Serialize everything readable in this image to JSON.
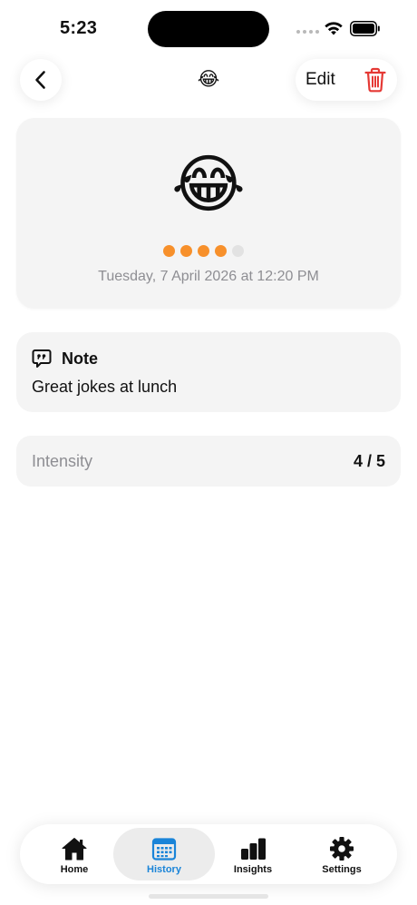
{
  "status_bar": {
    "time": "5:23"
  },
  "header": {
    "back_icon": "chevron-left-icon",
    "emoji": "😂",
    "edit_label": "Edit",
    "delete_icon": "trash-icon"
  },
  "mood": {
    "emoji": "😂",
    "intensity": 4,
    "intensity_max": 5,
    "date_text": "Tuesday, 7 April 2026 at 12:20 PM"
  },
  "note": {
    "title": "Note",
    "text": "Great jokes at lunch"
  },
  "intensity_row": {
    "label": "Intensity",
    "value": "4 / 5"
  },
  "tabs": [
    {
      "label": "Home",
      "icon": "house-icon",
      "active": false
    },
    {
      "label": "History",
      "icon": "calendar-icon",
      "active": true
    },
    {
      "label": "Insights",
      "icon": "bar-chart-icon",
      "active": false
    },
    {
      "label": "Settings",
      "icon": "gear-icon",
      "active": false
    }
  ],
  "colors": {
    "accent": "#1a84d8",
    "intensity_on": "#f7902b",
    "intensity_off": "#e2e2e2",
    "delete": "#e53935",
    "card_bg": "#f4f4f4",
    "secondary_text": "#8e8e93"
  }
}
